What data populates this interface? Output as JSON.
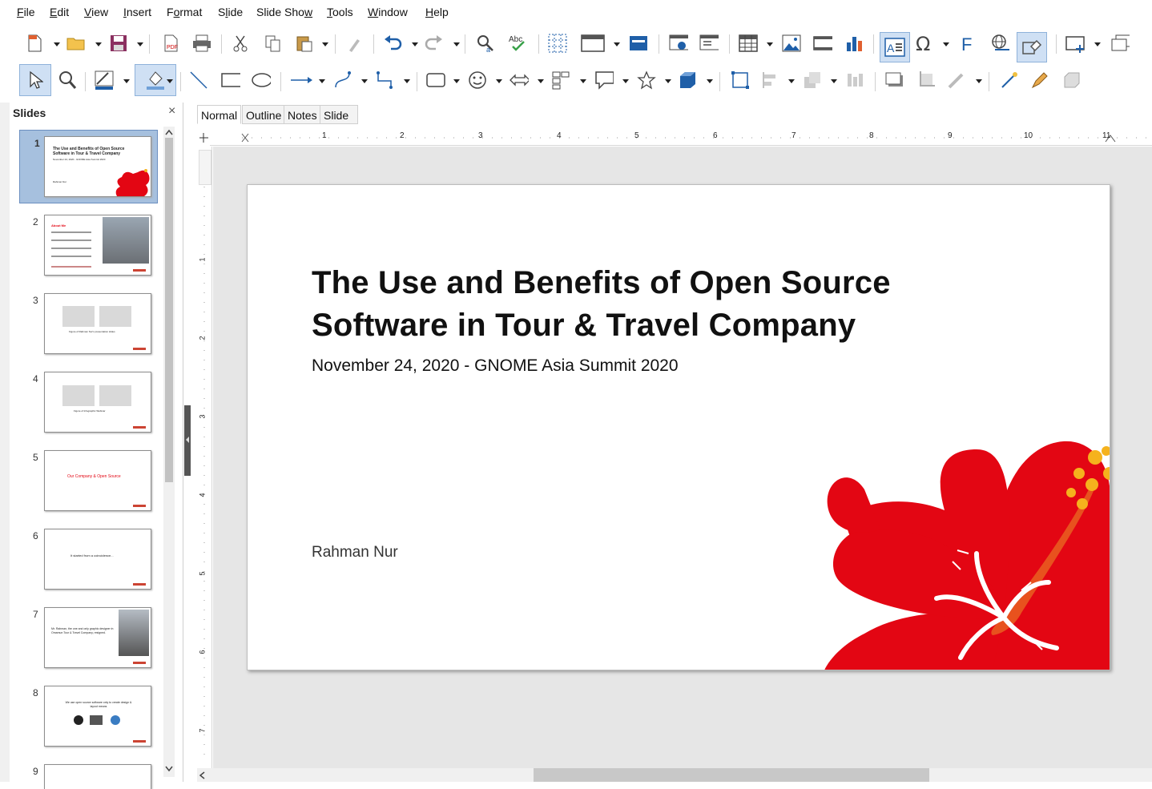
{
  "menu": [
    "File",
    "Edit",
    "View",
    "Insert",
    "Format",
    "Slide",
    "Slide Show",
    "Tools",
    "Window",
    "Help"
  ],
  "menu_mnemonics": [
    "F",
    "E",
    "V",
    "I",
    "o",
    "l",
    "w",
    "T",
    "W",
    "H"
  ],
  "slides_pane": {
    "title": "Slides",
    "close": "×"
  },
  "thumbs": [
    {
      "num": "1",
      "title": "The Use and Benefits of Open Source Software in Tour & Travel Company",
      "sub": "November 24, 2020 - GNOME Asia Summit 2020",
      "author": "Rahman Nur"
    },
    {
      "num": "2",
      "title": "About Me"
    },
    {
      "num": "3",
      "text": "Figure of Rahman Nur's presentation slides"
    },
    {
      "num": "4",
      "text": "Figure of Infographic Webinar"
    },
    {
      "num": "5",
      "text": "Our Company & Open Source"
    },
    {
      "num": "6",
      "text": "It started from a coincidence..."
    },
    {
      "num": "7",
      "text": "Mr. Rahman, the one and only graphic designer in Omamun Tour & Travel Company, resigned."
    },
    {
      "num": "8",
      "text": "We use open source software only to create design & layout means"
    },
    {
      "num": "9"
    }
  ],
  "view_tabs": [
    "Normal",
    "Outline",
    "Notes",
    "Slide Sorter"
  ],
  "ruler_numbers": [
    "1",
    "2",
    "3",
    "4",
    "5",
    "6",
    "7",
    "8",
    "9",
    "10",
    "11"
  ],
  "vruler_numbers": [
    "1",
    "2",
    "3",
    "4",
    "5",
    "6",
    "7"
  ],
  "slide": {
    "title_line1": "The Use and Benefits of Open Source",
    "title_line2": "Software in Tour & Travel Company",
    "subtitle": "November 24, 2020 - GNOME Asia Summit 2020",
    "author": "Rahman Nur"
  },
  "colors": {
    "accent_red": "#e30613",
    "stamen": "#e8521e",
    "pollen": "#f5b21d",
    "selection": "#a6c0de"
  },
  "icons": [
    "new-icon",
    "open-icon",
    "save-icon",
    "export-pdf-icon",
    "print-icon",
    "cut-icon",
    "copy-icon",
    "paste-icon",
    "clone-formatting-icon",
    "undo-icon",
    "redo-icon",
    "find-replace-icon",
    "spelling-icon",
    "grid-icon",
    "display-views-icon",
    "master-slide-icon",
    "start-slideshow-icon",
    "slide-layout-icon",
    "table-icon",
    "image-icon",
    "media-icon",
    "chart-icon",
    "textbox-icon",
    "special-character-icon",
    "fontwork-icon",
    "hyperlink-icon",
    "show-draw-functions-icon",
    "new-slide-icon",
    "duplicate-slide-icon"
  ]
}
